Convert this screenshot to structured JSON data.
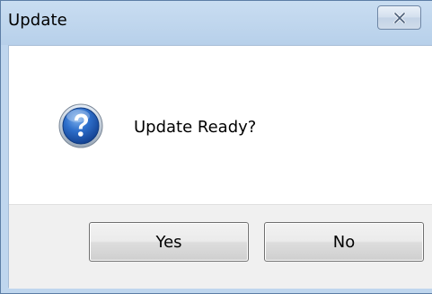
{
  "window": {
    "title": "Update"
  },
  "titlebar": {
    "close_icon": "close-icon"
  },
  "message": {
    "icon": "question-icon",
    "text": "Update Ready?"
  },
  "buttons": {
    "yes_label": "Yes",
    "no_label": "No"
  },
  "colors": {
    "titlebar": "#bfd6ee",
    "question_icon_blue": "#1f5fb8",
    "button_strip": "#f0f0f0"
  }
}
